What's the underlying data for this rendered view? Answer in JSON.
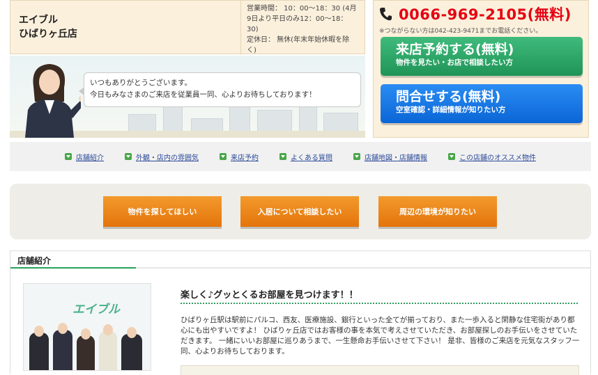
{
  "store": {
    "name_line1": "エイブル",
    "name_line2": "ひばりヶ丘店",
    "hours_line1": "営業時間： 10：00～18：30 (4月",
    "hours_line2": "9日より平日のみ12：00～18：",
    "hours_line3": "30)",
    "holiday_line1": "定休日： 無休(年末年始休暇を除",
    "holiday_line2": "く)"
  },
  "greeting": {
    "line1": "いつもありがとうございます。",
    "line2": "今日もみなさまのご来店を従業員一同、心よりお待ちしております！"
  },
  "contact": {
    "phone": "0066-969-2105(無料)",
    "note": "※つながらない方は042-423-9471までお電話ください。",
    "visit_title": "来店予約する(無料)",
    "visit_sub": "物件を見たい・お店で相談したい方",
    "inquiry_title": "問合せする(無料)",
    "inquiry_sub": "空室確認・詳細情報が知りたい方",
    "colors": {
      "phone": "#e60012",
      "visit": "#27a562",
      "inquiry": "#1577e8"
    }
  },
  "nav": {
    "items": [
      {
        "label": "店舗紹介"
      },
      {
        "label": "外観・店内の雰囲気"
      },
      {
        "label": "来店予約"
      },
      {
        "label": "よくある質問"
      },
      {
        "label": "店舗地図・店舗情報"
      },
      {
        "label": "この店舗のオススメ物件"
      }
    ]
  },
  "actions": {
    "find": "物件を探してほしい",
    "consult": "入居について相談したい",
    "area": "周辺の環境が知りたい",
    "color": "#ee8a1f"
  },
  "intro": {
    "section_title": "店舗紹介",
    "photo_logo": "エイブル",
    "headline": "楽しく♪グッとくるお部屋を見つけます！！",
    "body": "ひばりヶ丘駅は駅前にパルコ、西友、医療施設、銀行といった全てが揃っており、また一歩入ると閑静な住宅街があり都心にも出やすいですよ！ ひばりヶ丘店ではお客様の事を本気で考えさせていただき、お部屋探しのお手伝いをさせていただきます。 一緒にいいお部屋に巡りあうまで、一生懸命お手伝いさせて下さい！ 是非、皆様のご来店を元気なスタッフ一同、心よりお待ちしております。"
  }
}
